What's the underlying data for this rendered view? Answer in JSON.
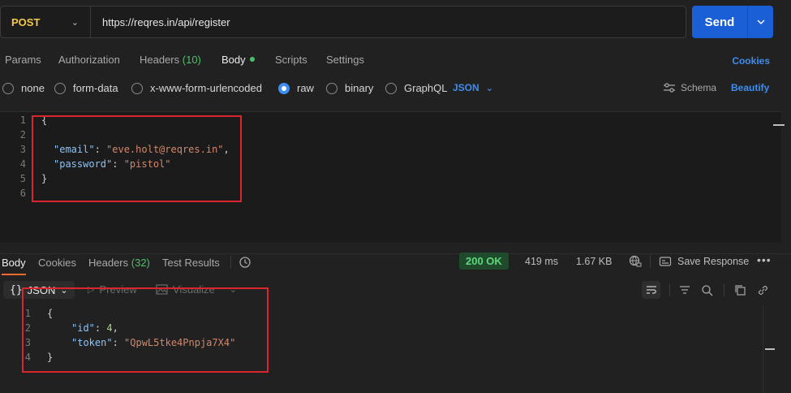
{
  "request": {
    "method": "POST",
    "url": "https://reqres.in/api/register",
    "send_label": "Send"
  },
  "request_tabs": {
    "params": "Params",
    "authorization": "Authorization",
    "headers": "Headers",
    "headers_count": "(10)",
    "body": "Body",
    "scripts": "Scripts",
    "settings": "Settings",
    "cookies": "Cookies"
  },
  "body_types": {
    "options": [
      "none",
      "form-data",
      "x-www-form-urlencoded",
      "raw",
      "binary",
      "GraphQL"
    ],
    "selected": "raw",
    "format": "JSON",
    "schema": "Schema",
    "beautify": "Beautify"
  },
  "request_body": {
    "line_numbers": [
      "1",
      "2",
      "3",
      "4",
      "5",
      "6"
    ],
    "open_brace": "{",
    "close_brace": "}",
    "email_key": "\"email\"",
    "email_value": "\"eve.holt@reqres.in\"",
    "password_key": "\"password\"",
    "password_value": "\"pistol\""
  },
  "response_tabs": {
    "body": "Body",
    "cookies": "Cookies",
    "headers": "Headers",
    "headers_count": "(32)",
    "test_results": "Test Results"
  },
  "response_meta": {
    "status": "200 OK",
    "time": "419 ms",
    "size": "1.67 KB",
    "save_response": "Save Response"
  },
  "response_toolbar": {
    "format": "JSON",
    "preview": "Preview",
    "visualize": "Visualize"
  },
  "response_body": {
    "line_numbers": [
      "1",
      "2",
      "3",
      "4"
    ],
    "open_brace": "{",
    "close_brace": "}",
    "id_key": "\"id\"",
    "id_value": "4",
    "token_key": "\"token\"",
    "token_value": "\"QpwL5tke4Pnpja7X4\""
  },
  "colors": {
    "accent": "#1a5fd6",
    "link": "#3d8ef0",
    "method": "#f3c94b",
    "status_ok": "#5fd77a",
    "highlight": "#d9252e"
  }
}
